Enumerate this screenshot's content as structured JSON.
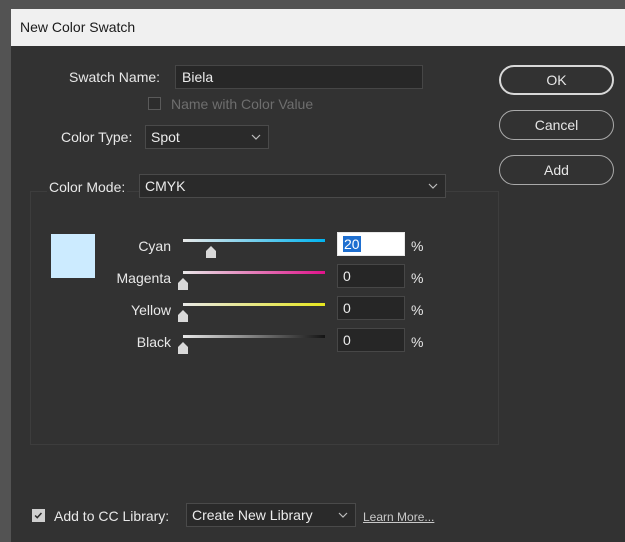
{
  "window": {
    "title": "New Color Swatch"
  },
  "form": {
    "swatch_name_label": "Swatch Name:",
    "swatch_name_value": "Biela",
    "name_with_color_value_label": "Name with Color Value",
    "name_with_color_value_checked": false,
    "color_type_label": "Color Type:",
    "color_type_value": "Spot",
    "color_mode_label": "Color Mode:",
    "color_mode_value": "CMYK"
  },
  "buttons": {
    "ok": "OK",
    "cancel": "Cancel",
    "add": "Add"
  },
  "swatch_color": "#ccebff",
  "channels": [
    {
      "label": "Cyan",
      "value": "20",
      "value_num": 20,
      "gradient_end": "#00b4f0"
    },
    {
      "label": "Magenta",
      "value": "0",
      "value_num": 0,
      "gradient_end": "#e0128a"
    },
    {
      "label": "Yellow",
      "value": "0",
      "value_num": 0,
      "gradient_end": "#e6e61e"
    },
    {
      "label": "Black",
      "value": "0",
      "value_num": 0,
      "gradient_end": "#141414"
    }
  ],
  "percent_sign": "%",
  "footer": {
    "add_to_library_label": "Add to CC Library:",
    "add_to_library_checked": true,
    "library_value": "Create New Library",
    "learn_more": "Learn More..."
  }
}
